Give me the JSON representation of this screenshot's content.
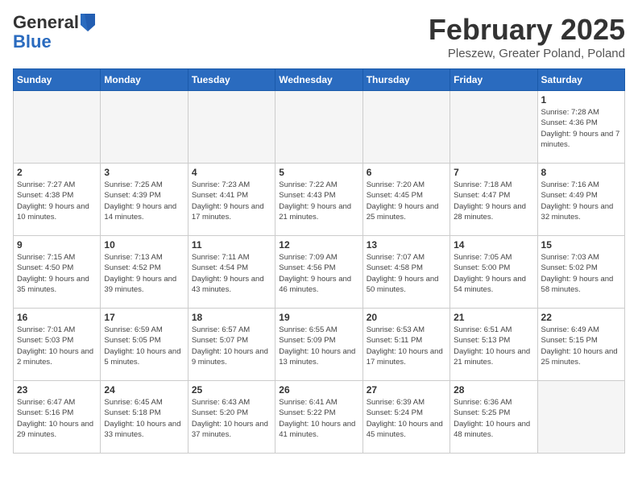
{
  "header": {
    "logo_general": "General",
    "logo_blue": "Blue",
    "month_title": "February 2025",
    "location": "Pleszew, Greater Poland, Poland"
  },
  "weekdays": [
    "Sunday",
    "Monday",
    "Tuesday",
    "Wednesday",
    "Thursday",
    "Friday",
    "Saturday"
  ],
  "weeks": [
    [
      {
        "day": "",
        "info": ""
      },
      {
        "day": "",
        "info": ""
      },
      {
        "day": "",
        "info": ""
      },
      {
        "day": "",
        "info": ""
      },
      {
        "day": "",
        "info": ""
      },
      {
        "day": "",
        "info": ""
      },
      {
        "day": "1",
        "info": "Sunrise: 7:28 AM\nSunset: 4:36 PM\nDaylight: 9 hours and 7 minutes."
      }
    ],
    [
      {
        "day": "2",
        "info": "Sunrise: 7:27 AM\nSunset: 4:38 PM\nDaylight: 9 hours and 10 minutes."
      },
      {
        "day": "3",
        "info": "Sunrise: 7:25 AM\nSunset: 4:39 PM\nDaylight: 9 hours and 14 minutes."
      },
      {
        "day": "4",
        "info": "Sunrise: 7:23 AM\nSunset: 4:41 PM\nDaylight: 9 hours and 17 minutes."
      },
      {
        "day": "5",
        "info": "Sunrise: 7:22 AM\nSunset: 4:43 PM\nDaylight: 9 hours and 21 minutes."
      },
      {
        "day": "6",
        "info": "Sunrise: 7:20 AM\nSunset: 4:45 PM\nDaylight: 9 hours and 25 minutes."
      },
      {
        "day": "7",
        "info": "Sunrise: 7:18 AM\nSunset: 4:47 PM\nDaylight: 9 hours and 28 minutes."
      },
      {
        "day": "8",
        "info": "Sunrise: 7:16 AM\nSunset: 4:49 PM\nDaylight: 9 hours and 32 minutes."
      }
    ],
    [
      {
        "day": "9",
        "info": "Sunrise: 7:15 AM\nSunset: 4:50 PM\nDaylight: 9 hours and 35 minutes."
      },
      {
        "day": "10",
        "info": "Sunrise: 7:13 AM\nSunset: 4:52 PM\nDaylight: 9 hours and 39 minutes."
      },
      {
        "day": "11",
        "info": "Sunrise: 7:11 AM\nSunset: 4:54 PM\nDaylight: 9 hours and 43 minutes."
      },
      {
        "day": "12",
        "info": "Sunrise: 7:09 AM\nSunset: 4:56 PM\nDaylight: 9 hours and 46 minutes."
      },
      {
        "day": "13",
        "info": "Sunrise: 7:07 AM\nSunset: 4:58 PM\nDaylight: 9 hours and 50 minutes."
      },
      {
        "day": "14",
        "info": "Sunrise: 7:05 AM\nSunset: 5:00 PM\nDaylight: 9 hours and 54 minutes."
      },
      {
        "day": "15",
        "info": "Sunrise: 7:03 AM\nSunset: 5:02 PM\nDaylight: 9 hours and 58 minutes."
      }
    ],
    [
      {
        "day": "16",
        "info": "Sunrise: 7:01 AM\nSunset: 5:03 PM\nDaylight: 10 hours and 2 minutes."
      },
      {
        "day": "17",
        "info": "Sunrise: 6:59 AM\nSunset: 5:05 PM\nDaylight: 10 hours and 5 minutes."
      },
      {
        "day": "18",
        "info": "Sunrise: 6:57 AM\nSunset: 5:07 PM\nDaylight: 10 hours and 9 minutes."
      },
      {
        "day": "19",
        "info": "Sunrise: 6:55 AM\nSunset: 5:09 PM\nDaylight: 10 hours and 13 minutes."
      },
      {
        "day": "20",
        "info": "Sunrise: 6:53 AM\nSunset: 5:11 PM\nDaylight: 10 hours and 17 minutes."
      },
      {
        "day": "21",
        "info": "Sunrise: 6:51 AM\nSunset: 5:13 PM\nDaylight: 10 hours and 21 minutes."
      },
      {
        "day": "22",
        "info": "Sunrise: 6:49 AM\nSunset: 5:15 PM\nDaylight: 10 hours and 25 minutes."
      }
    ],
    [
      {
        "day": "23",
        "info": "Sunrise: 6:47 AM\nSunset: 5:16 PM\nDaylight: 10 hours and 29 minutes."
      },
      {
        "day": "24",
        "info": "Sunrise: 6:45 AM\nSunset: 5:18 PM\nDaylight: 10 hours and 33 minutes."
      },
      {
        "day": "25",
        "info": "Sunrise: 6:43 AM\nSunset: 5:20 PM\nDaylight: 10 hours and 37 minutes."
      },
      {
        "day": "26",
        "info": "Sunrise: 6:41 AM\nSunset: 5:22 PM\nDaylight: 10 hours and 41 minutes."
      },
      {
        "day": "27",
        "info": "Sunrise: 6:39 AM\nSunset: 5:24 PM\nDaylight: 10 hours and 45 minutes."
      },
      {
        "day": "28",
        "info": "Sunrise: 6:36 AM\nSunset: 5:25 PM\nDaylight: 10 hours and 48 minutes."
      },
      {
        "day": "",
        "info": ""
      }
    ]
  ]
}
